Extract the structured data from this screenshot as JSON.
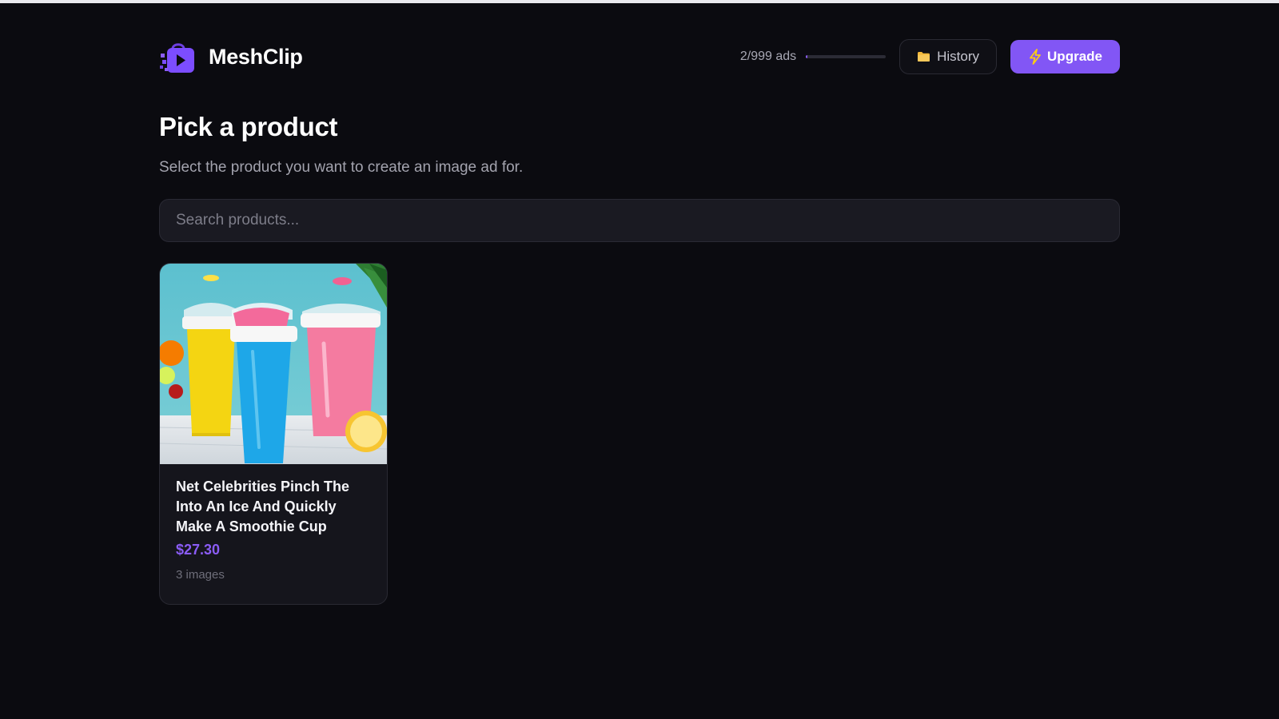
{
  "app": {
    "name": "MeshClip"
  },
  "header": {
    "usage_text": "2/999 ads",
    "usage_fraction": 0.002,
    "history_label": "History",
    "upgrade_label": "Upgrade"
  },
  "main": {
    "title": "Pick a product",
    "subtitle": "Select the product you want to create an image ad for.",
    "search_placeholder": "Search products..."
  },
  "products": [
    {
      "title": "Net Celebrities Pinch The Into An Ice And Quickly Make A Smoothie Cup",
      "price": "$27.30",
      "images": "3 images"
    }
  ],
  "icons": {
    "logo": "shopping-bag-play-icon",
    "history": "folder-icon",
    "upgrade": "lightning-bolt-icon"
  },
  "colors": {
    "background": "#0b0b10",
    "accent": "#8256f5",
    "price": "#8b5cf6",
    "folder": "#f5b93a",
    "bolt": "#facc15"
  }
}
